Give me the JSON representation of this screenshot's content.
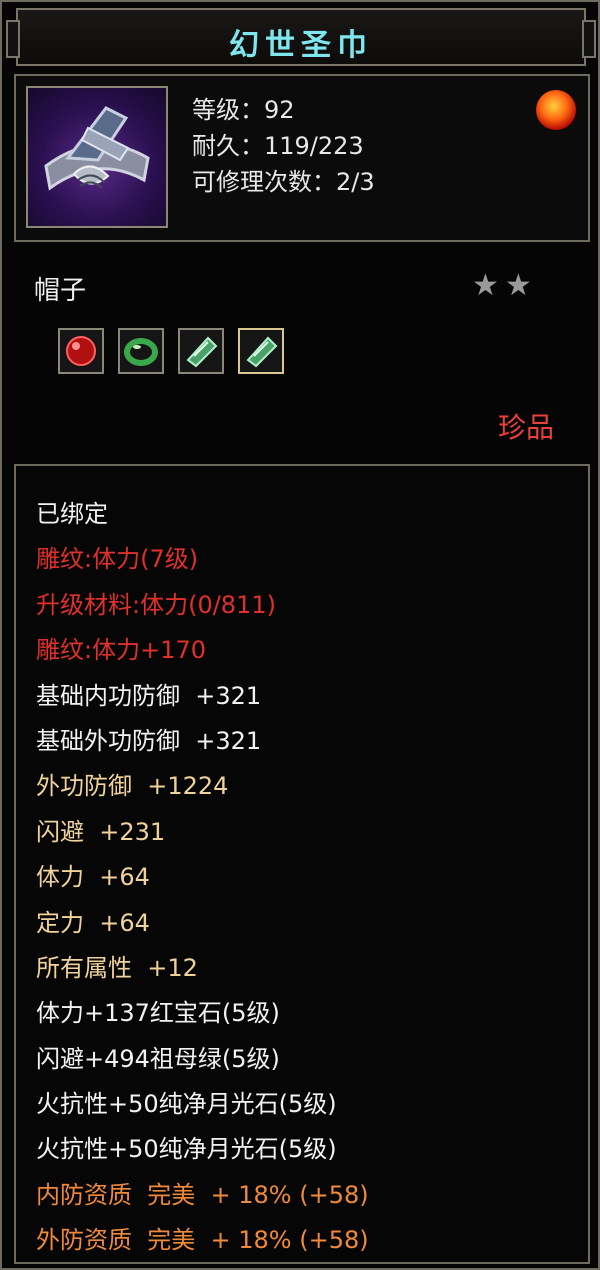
{
  "item": {
    "name": "幻世圣巾",
    "stats": [
      "等级：92",
      "耐久：119/223",
      "可修理次数：2/3"
    ],
    "type": "帽子",
    "stars": "★★",
    "quality": "珍品"
  },
  "gems": [
    {
      "name": "ruby-gem-icon",
      "color": "#c01818"
    },
    {
      "name": "jade-ring-gem-icon",
      "color": "#2f9a3a"
    },
    {
      "name": "green-crystal-gem-icon",
      "color": "#58c080"
    },
    {
      "name": "green-crystal-gem-icon",
      "color": "#58c080"
    }
  ],
  "attributes": [
    {
      "text": "已绑定",
      "color": "white"
    },
    {
      "text": "雕纹:体力(7级)",
      "color": "red"
    },
    {
      "text": "升级材料:体力(0/811)",
      "color": "red"
    },
    {
      "text": "雕纹:体力+170",
      "color": "red"
    },
    {
      "text": "基础内功防御  +321",
      "color": "white"
    },
    {
      "text": "基础外功防御  +321",
      "color": "white"
    },
    {
      "text": "外功防御  +1224",
      "color": "yellow"
    },
    {
      "text": "闪避  +231",
      "color": "yellow"
    },
    {
      "text": "体力  +64",
      "color": "yellow"
    },
    {
      "text": "定力  +64",
      "color": "yellow"
    },
    {
      "text": "所有属性  +12",
      "color": "yellow"
    },
    {
      "text": "体力+137红宝石(5级)",
      "color": "white"
    },
    {
      "text": "闪避+494祖母绿(5级)",
      "color": "white"
    },
    {
      "text": "火抗性+50纯净月光石(5级)",
      "color": "white"
    },
    {
      "text": "火抗性+50纯净月光石(5级)",
      "color": "white"
    },
    {
      "text": "内防资质  完美  + 18% (+58)",
      "color": "orange"
    },
    {
      "text": "外防资质  完美  + 18% (+58)",
      "color": "orange"
    }
  ]
}
